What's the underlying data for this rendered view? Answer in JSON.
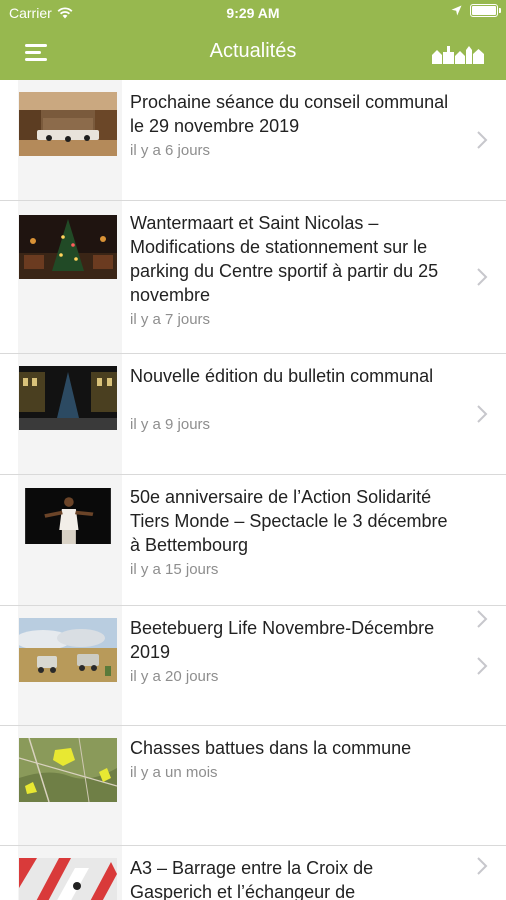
{
  "status_bar": {
    "carrier": "Carrier",
    "time": "9:29 AM"
  },
  "nav": {
    "title": "Actualités",
    "menu_icon": "hamburger-menu-icon",
    "town_icon": "town-silhouette-icon"
  },
  "colors": {
    "header": "#97b84f",
    "text": "#222222",
    "muted": "#8e8e8e",
    "separator": "#d9d9d9"
  },
  "news": [
    {
      "title": "Prochaine séance du conseil communal le 29 novembre 2019",
      "date": "il y a 6 jours"
    },
    {
      "title": "Wantermaart et Saint Nicolas – Modifications de stationnement sur le parking du Centre sportif à partir du 25 novembre",
      "date": "il y a 7 jours"
    },
    {
      "title": "Nouvelle édition du bulletin communal",
      "date": "il y a 9 jours"
    },
    {
      "title": "50e anniversaire de l’Action Solidarité Tiers Monde – Spectacle le 3 décembre à Bettembourg",
      "date": "il y a 15 jours"
    },
    {
      "title": "Beetebuerg Life Novembre-Décembre 2019",
      "date": "il y a 20 jours"
    },
    {
      "title": "Chasses battues dans la commune",
      "date": "il y a un mois"
    },
    {
      "title": "A3 – Barrage entre la Croix de Gasperich et l’échangeur de",
      "date": ""
    }
  ]
}
